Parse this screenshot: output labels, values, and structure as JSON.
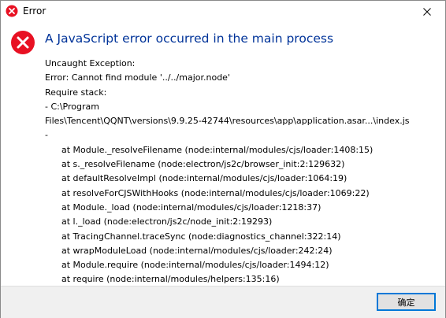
{
  "window": {
    "title": "Error",
    "title_icon": "error-icon",
    "close_icon": "close-icon"
  },
  "dialog": {
    "heading": "A JavaScript error occurred in the main process",
    "heading_color": "#003399",
    "icon": "error-icon",
    "icon_color": "#e81123",
    "lines": [
      "Uncaught Exception:",
      "Error: Cannot find module '../../major.node'",
      "Require stack:",
      "- C:\\Program",
      "Files\\Tencent\\QQNT\\versions\\9.9.25-42744\\resources\\app\\application.asar...\\index.js",
      "-",
      "      at Module._resolveFilename (node:internal/modules/cjs/loader:1408:15)",
      "      at s._resolveFilename (node:electron/js2c/browser_init:2:129632)",
      "      at defaultResolveImpl (node:internal/modules/cjs/loader:1064:19)",
      "      at resolveForCJSWithHooks (node:internal/modules/cjs/loader:1069:22)",
      "      at Module._load (node:internal/modules/cjs/loader:1218:37)",
      "      at l._load (node:electron/js2c/node_init:2:19293)",
      "      at TracingChannel.traceSync (node:diagnostics_channel:322:14)",
      "      at wrapModuleLoad (node:internal/modules/cjs/loader:242:24)",
      "      at Module.require (node:internal/modules/cjs/loader:1494:12)",
      "      at require (node:internal/modules/helpers:135:16)"
    ]
  },
  "footer": {
    "ok_label": "确定"
  }
}
